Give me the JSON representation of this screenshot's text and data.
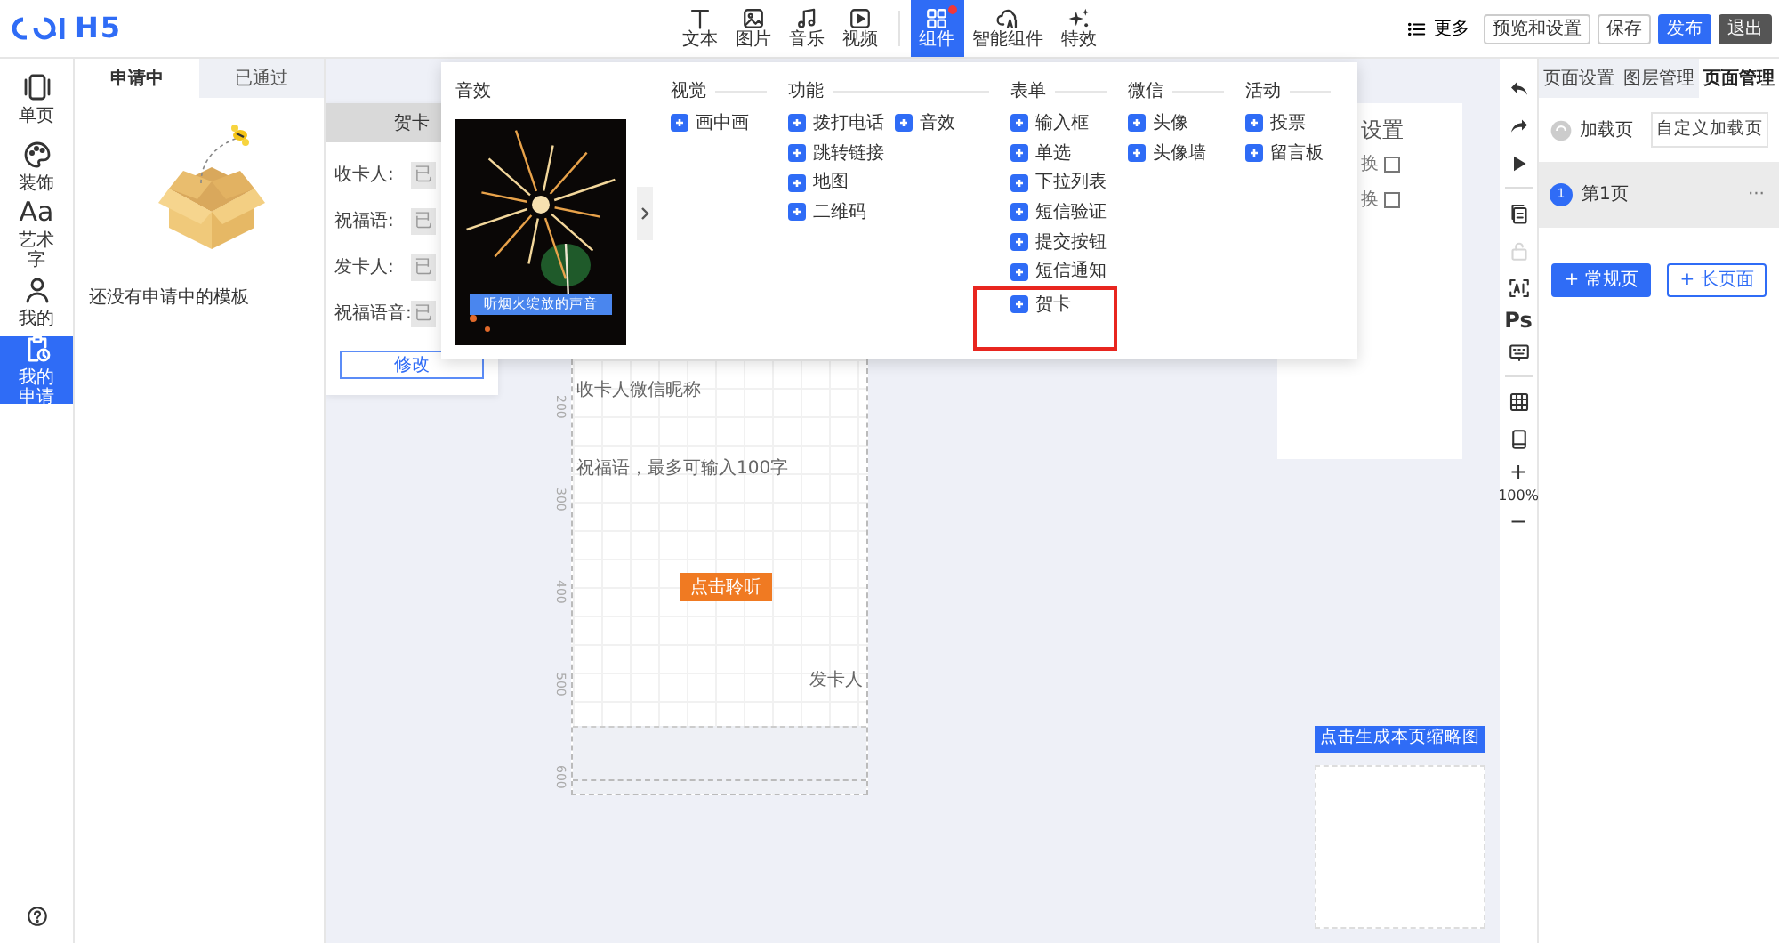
{
  "topbar": {
    "logo": "H5",
    "tools": [
      {
        "label": "文本",
        "divider_before": false,
        "selected": false,
        "badge": false
      },
      {
        "label": "图片",
        "divider_before": false,
        "selected": false,
        "badge": false
      },
      {
        "label": "音乐",
        "divider_before": false,
        "selected": false,
        "badge": false
      },
      {
        "label": "视频",
        "divider_before": false,
        "selected": false,
        "badge": false
      },
      {
        "label": "组件",
        "divider_before": true,
        "selected": true,
        "badge": true
      },
      {
        "label": "智能组件",
        "divider_before": false,
        "selected": false,
        "badge": false
      },
      {
        "label": "特效",
        "divider_before": false,
        "selected": false,
        "badge": false
      }
    ],
    "more": "更多",
    "buttons": [
      {
        "label": "预览和设置",
        "kind": "outline"
      },
      {
        "label": "保存",
        "kind": "outline"
      },
      {
        "label": "发布",
        "kind": "primary"
      },
      {
        "label": "退出",
        "kind": "dark"
      }
    ]
  },
  "sidebar": {
    "items": [
      {
        "label": "单页",
        "selected": false
      },
      {
        "label": "装饰",
        "selected": false
      },
      {
        "label": "艺术字",
        "glyph": "Aa",
        "selected": false
      },
      {
        "label": "我的",
        "selected": false
      },
      {
        "label": "我的申请",
        "selected": true
      }
    ]
  },
  "template_panel": {
    "tabs": [
      {
        "label": "申请中",
        "selected": true
      },
      {
        "label": "已通过",
        "selected": false
      }
    ],
    "empty_text": "还没有申请中的模板"
  },
  "card_panel": {
    "title": "贺卡",
    "fields": [
      {
        "label": "收卡人:",
        "value": "已"
      },
      {
        "label": "祝福语:",
        "value": "已"
      },
      {
        "label": "发卡人:",
        "value": "已"
      },
      {
        "label": "祝福语音:",
        "value": "已"
      }
    ],
    "button": "修改"
  },
  "component_menu": {
    "preview": {
      "title": "音效",
      "button": "听烟火绽放的声音"
    },
    "sections": [
      {
        "title": "视觉",
        "columns": [
          [
            {
              "label": "画中画",
              "highlighted": false
            }
          ]
        ]
      },
      {
        "title": "功能",
        "columns": [
          [
            {
              "label": "拨打电话",
              "highlighted": false
            },
            {
              "label": "跳转链接",
              "highlighted": false
            },
            {
              "label": "地图",
              "highlighted": false
            },
            {
              "label": "二维码",
              "highlighted": false
            }
          ],
          [
            {
              "label": "音效",
              "highlighted": false
            }
          ]
        ]
      },
      {
        "title": "表单",
        "columns": [
          [
            {
              "label": "输入框",
              "highlighted": false
            },
            {
              "label": "单选",
              "highlighted": false
            },
            {
              "label": "下拉列表",
              "highlighted": false
            },
            {
              "label": "短信验证",
              "highlighted": false
            },
            {
              "label": "提交按钮",
              "highlighted": false
            },
            {
              "label": "短信通知",
              "highlighted": false
            },
            {
              "label": "贺卡",
              "highlighted": true
            }
          ]
        ]
      },
      {
        "title": "微信",
        "columns": [
          [
            {
              "label": "头像",
              "highlighted": false
            },
            {
              "label": "头像墙",
              "highlighted": false
            }
          ]
        ]
      },
      {
        "title": "活动",
        "columns": [
          [
            {
              "label": "投票",
              "highlighted": false
            },
            {
              "label": "留言板",
              "highlighted": false
            }
          ]
        ]
      }
    ]
  },
  "canvas": {
    "ruler": [
      "200",
      "300",
      "400",
      "500",
      "600"
    ],
    "recipient": "收卡人微信昵称",
    "message": "祝福语，最多可输入100字",
    "listen_button": "点击聆听",
    "sender": "发卡人"
  },
  "settings_panel": {
    "title": "设置",
    "options": [
      {
        "label": "换",
        "checked": false
      },
      {
        "label": "换",
        "checked": false
      }
    ]
  },
  "thumbnail": {
    "button": "点击生成本页缩略图"
  },
  "tools": [
    {
      "kind": "undo",
      "disabled": false
    },
    {
      "kind": "redo",
      "disabled": false
    },
    {
      "kind": "play",
      "disabled": false
    },
    {
      "kind": "divider"
    },
    {
      "kind": "copy",
      "disabled": false
    },
    {
      "kind": "lock",
      "disabled": true
    },
    {
      "kind": "ai",
      "disabled": false
    },
    {
      "kind": "text",
      "label": "Ps",
      "disabled": false
    },
    {
      "kind": "keyboard",
      "disabled": false
    },
    {
      "kind": "divider"
    },
    {
      "kind": "table",
      "disabled": false
    },
    {
      "kind": "phone",
      "disabled": false
    },
    {
      "kind": "text",
      "label": "+",
      "disabled": false
    },
    {
      "kind": "text",
      "label": "100%",
      "disabled": false
    },
    {
      "kind": "text",
      "label": "−",
      "disabled": false
    }
  ],
  "page_panel": {
    "tabs": [
      {
        "label": "页面设置",
        "selected": false
      },
      {
        "label": "图层管理",
        "selected": false
      },
      {
        "label": "页面管理",
        "selected": true
      }
    ],
    "loading_page": {
      "label": "加载页",
      "button": "自定义加载页"
    },
    "pages": [
      {
        "number": "1",
        "label": "第1页",
        "selected": true,
        "menu": "···"
      }
    ],
    "buttons": [
      {
        "label": "+ 常规页",
        "kind": "primary"
      },
      {
        "label": "+ 长页面",
        "kind": "outline"
      }
    ]
  }
}
